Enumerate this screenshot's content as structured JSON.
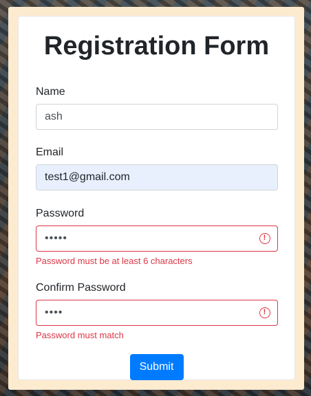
{
  "form": {
    "title": "Registration Form",
    "name": {
      "label": "Name",
      "value": "ash"
    },
    "email": {
      "label": "Email",
      "value": "test1@gmail.com"
    },
    "password": {
      "label": "Password",
      "value": "•••••",
      "error": "Password must be at least 6 characters"
    },
    "confirm_password": {
      "label": "Confirm Password",
      "value": "••••",
      "error": "Password must match"
    },
    "submit_label": "Submit"
  },
  "colors": {
    "accent": "#007bff",
    "error": "#dc3545",
    "autofill_bg": "#e8f0fe",
    "frame_bg": "#fdebd0"
  },
  "icons": {
    "invalid": "alert-circle-icon",
    "invalid_glyph": "!"
  }
}
